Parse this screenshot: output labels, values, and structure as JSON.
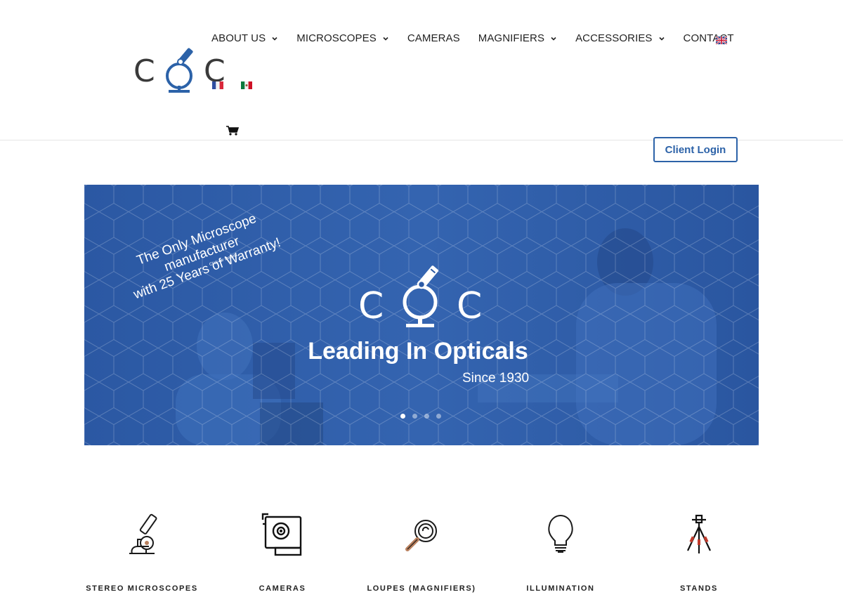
{
  "logo": {
    "letter_left": "C",
    "letter_right": "C"
  },
  "nav": {
    "items": [
      {
        "label": "ABOUT US",
        "has_dropdown": true
      },
      {
        "label": "MICROSCOPES",
        "has_dropdown": true
      },
      {
        "label": "CAMERAS",
        "has_dropdown": false
      },
      {
        "label": "MAGNIFIERS",
        "has_dropdown": true
      },
      {
        "label": "ACCESSORIES",
        "has_dropdown": true
      },
      {
        "label": "CONTACT",
        "has_dropdown": false
      }
    ],
    "languages": [
      "English",
      "French",
      "Mexican Spanish"
    ]
  },
  "header": {
    "client_login_label": "Client Login"
  },
  "hero": {
    "promo_line1": "The Only Microscope manufacturer",
    "promo_line2": "with 25 Years of Warranty!",
    "promo_small": "Click for Details",
    "logo_letter_left": "C",
    "logo_letter_right": "C",
    "title": "Leading In Opticals",
    "subtitle": "Since 1930",
    "slides_total": 4,
    "active_slide": 1
  },
  "categories": [
    {
      "label": "STEREO MICROSCOPES",
      "icon": "microscope-icon"
    },
    {
      "label": "CAMERAS",
      "icon": "camera-icon"
    },
    {
      "label": "LOUPES (MAGNIFIERS)",
      "icon": "magnifier-icon"
    },
    {
      "label": "ILLUMINATION",
      "icon": "lightbulb-icon"
    },
    {
      "label": "STANDS",
      "icon": "tripod-stand-icon"
    }
  ],
  "colors": {
    "brand_blue": "#2c62a8",
    "hero_overlay": "#2d5ba6",
    "text": "#222222"
  }
}
